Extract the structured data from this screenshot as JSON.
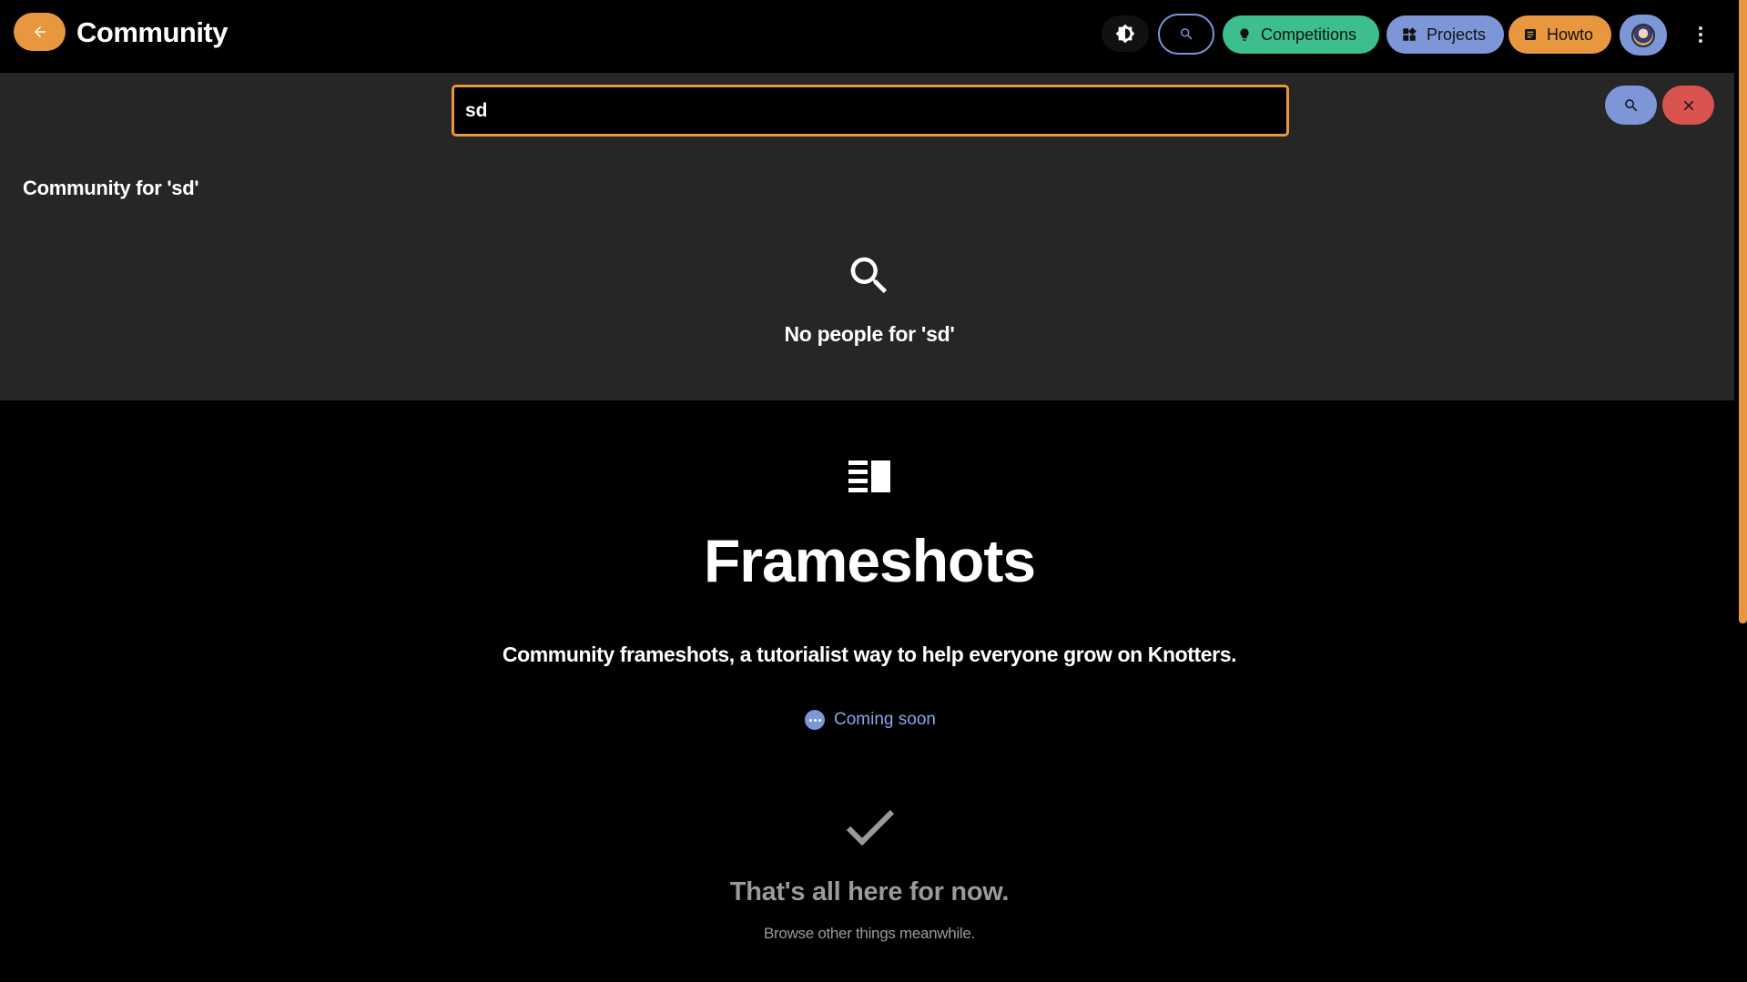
{
  "header": {
    "title": "Community",
    "back_icon": "arrow-left-icon",
    "theme_icon": "brightness-icon",
    "search_icon": "search-icon",
    "nav": [
      {
        "label": "Competitions",
        "icon": "lightbulb-icon",
        "color": "#3cbf8c"
      },
      {
        "label": "Projects",
        "icon": "widgets-icon",
        "color": "#7c96d8"
      },
      {
        "label": "Howto",
        "icon": "article-icon",
        "color": "#e8973f"
      }
    ],
    "avatar_icon": "user-avatar",
    "more_icon": "more-vertical-icon"
  },
  "search": {
    "value": "sd",
    "submit_icon": "search-icon",
    "clear_icon": "close-icon",
    "results_heading": "Community for 'sd'",
    "empty_icon": "search-icon",
    "empty_message": "No people for 'sd'"
  },
  "frameshots": {
    "icon": "vertical-split-icon",
    "title": "Frameshots",
    "description": "Community frameshots, a tutorialist way to help everyone grow on Knotters.",
    "status_icon": "pending-icon",
    "status_label": "Coming soon"
  },
  "end": {
    "icon": "check-icon",
    "title": "That's all here for now.",
    "subtitle": "Browse other things meanwhile."
  },
  "colors": {
    "accent": "#e8973f",
    "primary": "#7c96d8",
    "success": "#3cbf8c",
    "danger": "#d9534f",
    "panel": "#262626",
    "background": "#000000"
  }
}
